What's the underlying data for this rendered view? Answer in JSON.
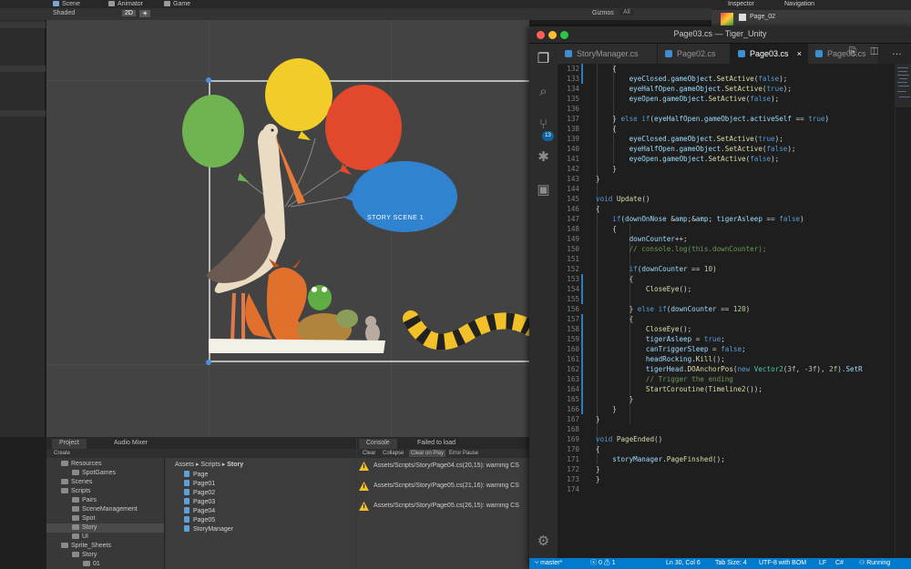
{
  "unity": {
    "tabs": {
      "scene": "Scene",
      "animator": "Animator",
      "game": "Game"
    },
    "toolbar": {
      "shading": "Shaded",
      "mode_2d": "2D",
      "gizmos": "Gizmos",
      "search_all": "All"
    },
    "scene_label": "STORY SCENE 1",
    "inspector": {
      "tab": "Inspector",
      "nav_tab": "Navigation",
      "object_name": "Page_02"
    },
    "project": {
      "tab": "Project",
      "audio_tab": "Audio Mixer",
      "create": "Create",
      "tree": [
        {
          "label": "Resources",
          "depth": 1
        },
        {
          "label": "SpotGames",
          "depth": 2
        },
        {
          "label": "Scenes",
          "depth": 1
        },
        {
          "label": "Scripts",
          "depth": 1
        },
        {
          "label": "Pairs",
          "depth": 2
        },
        {
          "label": "SceneManagement",
          "depth": 2
        },
        {
          "label": "Spot",
          "depth": 2
        },
        {
          "label": "Story",
          "depth": 2
        },
        {
          "label": "UI",
          "depth": 2
        },
        {
          "label": "Sprite_Sheets",
          "depth": 1
        },
        {
          "label": "Story",
          "depth": 2
        },
        {
          "label": "01",
          "depth": 3
        }
      ],
      "breadcrumb": [
        "Assets",
        "Scripts",
        "Story"
      ],
      "files": [
        "Page",
        "Page01",
        "Page02",
        "Page03",
        "Page04",
        "Page05",
        "StoryManager"
      ]
    },
    "console": {
      "tab": "Console",
      "status_tab": "Failed to load",
      "buttons": {
        "clear": "Clear",
        "collapse": "Collapse",
        "clear_on_play": "Clear on Play",
        "error_pause": "Error Pause"
      },
      "messages": [
        "Assets/Scripts/Story/Page04.cs(20,15): warning CS",
        "Assets/Scripts/Story/Page05.cs(21,16): warning CS",
        "Assets/Scripts/Story/Page05.cs(26,15): warning CS"
      ]
    }
  },
  "vscode": {
    "window_title": "Page03.cs — Tiger_Unity",
    "tabs": [
      {
        "label": "StoryManager.cs",
        "active": false
      },
      {
        "label": "Page02.cs",
        "active": false
      },
      {
        "label": "Page03.cs",
        "active": true
      },
      {
        "label": "Page05.cs",
        "active": false
      }
    ],
    "close_glyph": "×",
    "tab_actions": "⎘ ◫ …",
    "activity": {
      "scm_badge": "13"
    },
    "line_numbers": [
      "132",
      "133",
      "134",
      "135",
      "136",
      "137",
      "138",
      "139",
      "140",
      "141",
      "142",
      "143",
      "144",
      "145",
      "146",
      "147",
      "148",
      "149",
      "150",
      "151",
      "152",
      "153",
      "154",
      "155",
      "156",
      "157",
      "158",
      "159",
      "160",
      "161",
      "162",
      "163",
      "164",
      "165",
      "166",
      "167",
      "168",
      "169",
      "170",
      "171",
      "172",
      "173",
      "174"
    ],
    "code_lines": [
      "    {",
      "        eyeClosed.gameObject.SetActive(false);",
      "        eyeHalfOpen.gameObject.SetActive(true);",
      "        eyeOpen.gameObject.SetActive(false);",
      "",
      "    } else if(eyeHalfOpen.gameObject.activeSelf == true)",
      "    {",
      "        eyeClosed.gameObject.SetActive(true);",
      "        eyeHalfOpen.gameObject.SetActive(false);",
      "        eyeOpen.gameObject.SetActive(false);",
      "    }",
      "}",
      "",
      "void Update()",
      "{",
      "    if(downOnNose && tigerAsleep == false)",
      "    {",
      "        downCounter++;",
      "        // console.log(this.downCounter);",
      "",
      "        if(downCounter == 10)",
      "        {",
      "            CloseEye();",
      "",
      "        } else if(downCounter == 120)",
      "        {",
      "            CloseEye();",
      "            tigerAsleep = true;",
      "            canTriggerSleep = false;",
      "            headRocking.Kill();",
      "            tigerHead.DOAnchorPos(new Vector2(3f, -3f), 2f).SetR",
      "            // Trigger the ending",
      "            StartCoroutine(Timeline2());",
      "        }",
      "    }",
      "}",
      "",
      "void PageEnded()",
      "{",
      "    storyManager.PageFinshed();",
      "}",
      "}",
      ""
    ],
    "status": {
      "branch": "master*",
      "problems": "ⓧ 0 ⚠ 1",
      "position": "Ln 30, Col 6",
      "tab_size": "Tab Size: 4",
      "encoding": "UTF-8 with BOM",
      "eol": "LF",
      "language": "C#",
      "running": "Running"
    },
    "colors": {
      "statusbar": "#007acc",
      "keyword": "#569cd6",
      "type": "#4ec9b0",
      "function": "#dcdcaa",
      "comment": "#6a9955"
    }
  }
}
